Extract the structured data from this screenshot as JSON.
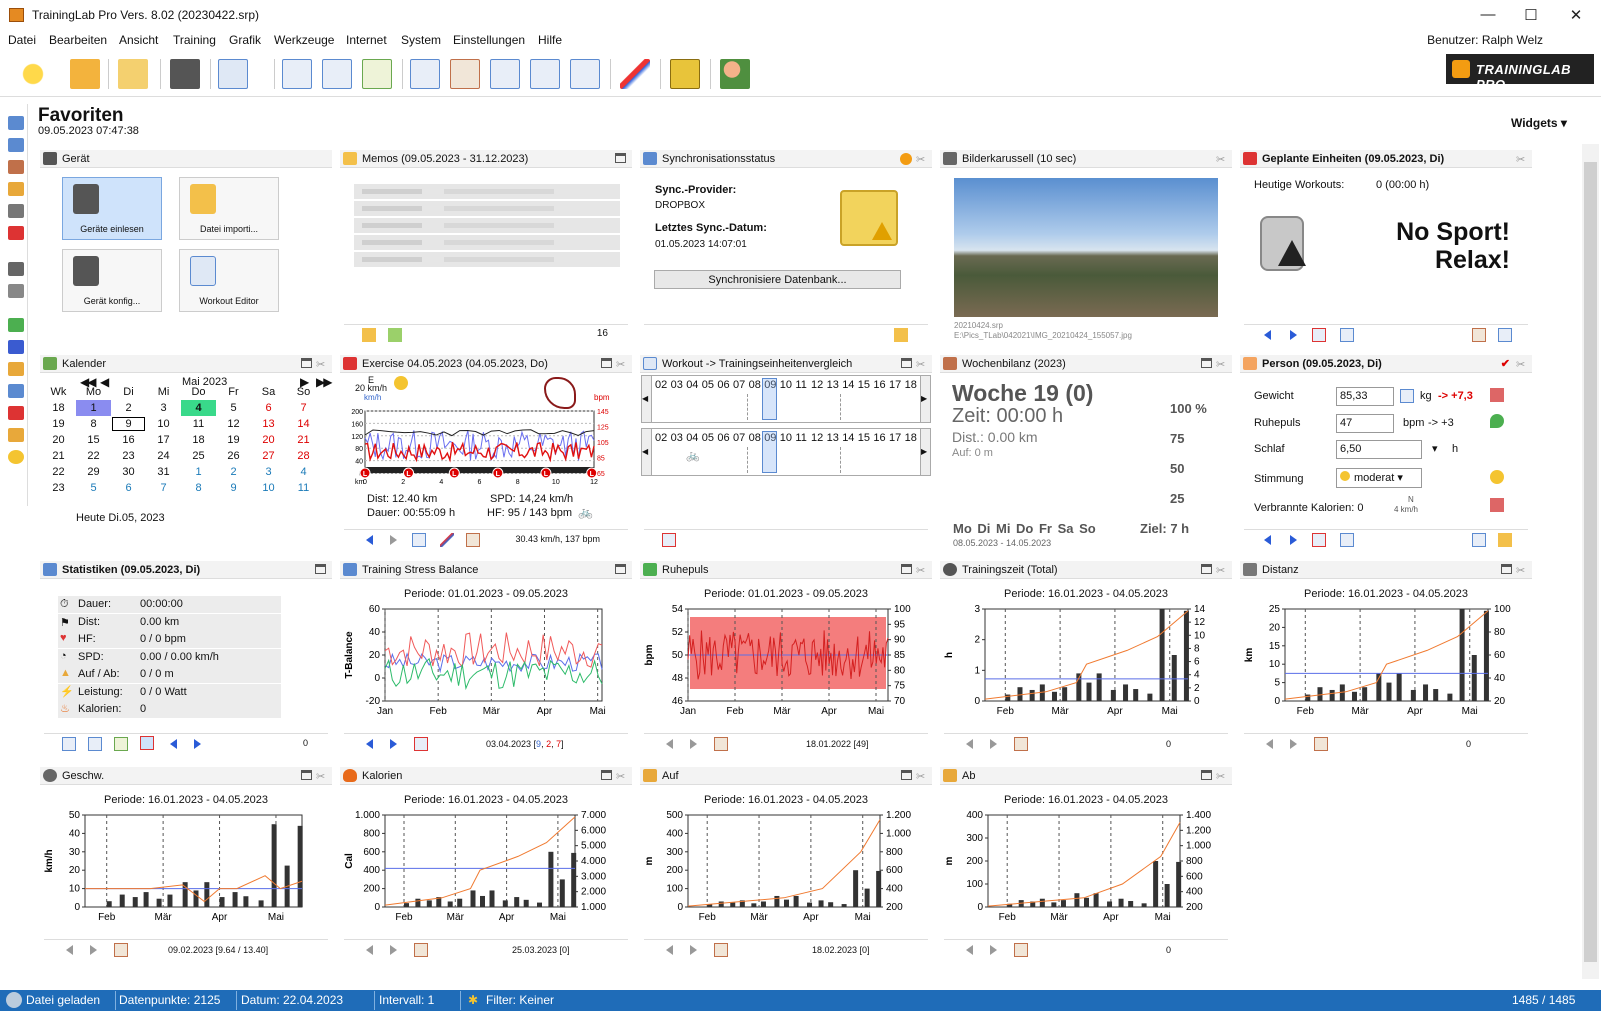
{
  "window": {
    "title": "TrainingLab Pro Vers. 8.02 (20230422.srp)",
    "minimize": "—",
    "maximize": "☐",
    "close": "✕"
  },
  "menu": [
    "Datei",
    "Bearbeiten",
    "Ansicht",
    "Training",
    "Grafik",
    "Werkzeuge",
    "Internet",
    "System",
    "Einstellungen",
    "Hilfe"
  ],
  "user": "Benutzer: Ralph Welz",
  "logo": "TRAININGLAB PRO",
  "page": {
    "title": "Favoriten",
    "date": "09.05.2023 07:47:38",
    "widgets": "Widgets"
  },
  "panels": {
    "geraet": {
      "title": "Gerät",
      "b1": "Geräte einlesen",
      "b2": "Datei importi...",
      "b3": "Gerät konfig...",
      "b4": "Workout Editor"
    },
    "memos": {
      "title": "Memos (09.05.2023 - 31.12.2023)",
      "count": "16"
    },
    "sync": {
      "title": "Synchronisationsstatus",
      "provider_label": "Sync.-Provider:",
      "provider": "DROPBOX",
      "last_label": "Letztes Sync.-Datum:",
      "last": "01.05.2023 14:07:01",
      "button": "Synchronisiere Datenbank..."
    },
    "bilder": {
      "title": "Bilderkarussell (10 sec)",
      "file": "20210424.srp",
      "path": "E:\\Pics_TLab\\042021\\IMG_20210424_155057.jpg"
    },
    "geplant": {
      "title": "Geplante Einheiten (09.05.2023, Di)",
      "label": "Heutige Workouts:",
      "value": "0 (00:00 h)",
      "line1": "No Sport!",
      "line2": "Relax!"
    },
    "kalender": {
      "title": "Kalender",
      "month": "Mai 2023",
      "today": "Heute Di.05, 2023",
      "head": [
        "Wk",
        "Mo",
        "Di",
        "Mi",
        "Do",
        "Fr",
        "Sa",
        "So"
      ],
      "rows": [
        [
          "18",
          "1",
          "2",
          "3",
          "4",
          "5",
          "6",
          "7"
        ],
        [
          "19",
          "8",
          "9",
          "10",
          "11",
          "12",
          "13",
          "14"
        ],
        [
          "20",
          "15",
          "16",
          "17",
          "18",
          "19",
          "20",
          "21"
        ],
        [
          "21",
          "22",
          "23",
          "24",
          "25",
          "26",
          "27",
          "28"
        ],
        [
          "22",
          "29",
          "30",
          "31",
          "1",
          "2",
          "3",
          "4"
        ],
        [
          "23",
          "5",
          "6",
          "7",
          "8",
          "9",
          "10",
          "11"
        ]
      ]
    },
    "exercise": {
      "title": "Exercise 04.05.2023 (04.05.2023, Do)",
      "wind": "20 km/h",
      "dir": "E",
      "dist": "Dist: 12.40 km",
      "spd": "SPD: 14,24 km/h",
      "dauer": "Dauer: 00:55:09 h",
      "hf": "HF: 95 / 143 bpm",
      "foot": "30.43 km/h, 137 bpm",
      "unit_l": "km/h",
      "unit_r": "bpm",
      "xlab": "km",
      "y_left": [
        "200",
        "160",
        "120",
        "80",
        "40",
        "0"
      ],
      "y_right": [
        "145",
        "125",
        "105",
        "85",
        "65"
      ],
      "x_ticks": [
        "0",
        "2",
        "4",
        "6",
        "8",
        "10",
        "12"
      ]
    },
    "workout": {
      "title": "Workout -> Trainingseinheitenvergleich",
      "nums": [
        "02",
        "03",
        "04",
        "05",
        "06",
        "07",
        "08",
        "09",
        "10",
        "11",
        "12",
        "13",
        "14",
        "15",
        "16",
        "17",
        "18"
      ]
    },
    "woche": {
      "title": "Wochenbilanz (2023)",
      "week": "Woche 19 (0)",
      "zeit": "Zeit: 00:00 h",
      "dist": "Dist.: 0.00 km",
      "auf": "Auf: 0 m",
      "p100": "100 %",
      "p75": "75",
      "p50": "50",
      "p25": "25",
      "days": "Mo Di Mi Do Fr Sa So",
      "ziel": "Ziel: 7 h",
      "range": "08.05.2023 - 14.05.2023"
    },
    "person": {
      "title": "Person (09.05.2023, Di)",
      "gewicht_l": "Gewicht",
      "gewicht": "85,33",
      "kg": "kg",
      "delta": "-> +7,3",
      "ruhe_l": "Ruhepuls",
      "ruhe": "47",
      "bpm": "bpm",
      "ruhe_d": "-> +3",
      "schlaf_l": "Schlaf",
      "schlaf": "6,50",
      "h": "h",
      "stimmung_l": "Stimmung",
      "stimmung": "moderat",
      "kal_l": "Verbrannte Kalorien: 0",
      "wind_dir": "N",
      "wind": "4 km/h"
    },
    "stat": {
      "title": "Statistiken (09.05.2023, Di)",
      "rows": [
        [
          "Dauer:",
          "00:00:00"
        ],
        [
          "Dist:",
          "0.00 km"
        ],
        [
          "HF:",
          "0 / 0 bpm"
        ],
        [
          "SPD:",
          "0.00 / 0.00 km/h"
        ],
        [
          "Auf / Ab:",
          "0 / 0 m"
        ],
        [
          "Leistung:",
          "0 / 0 Watt"
        ],
        [
          "Kalorien:",
          "0"
        ]
      ],
      "count": "0"
    },
    "tsb": {
      "title": "Training Stress Balance",
      "period": "Periode: 01.01.2023 - 09.05.2023",
      "ylabel": "T-Balance",
      "foot_date": "03.04.2023 [",
      "foot_a": "9",
      "foot_sep": ", ",
      "foot_b": "2",
      "foot_sep2": ", ",
      "foot_c": "7",
      "foot_end": "]",
      "months": [
        "Jan",
        "Feb",
        "Mär",
        "Apr",
        "Mai"
      ],
      "yticks": [
        "60",
        "40",
        "20",
        "0",
        "-20"
      ]
    },
    "ruhepuls": {
      "title": "Ruhepuls",
      "period": "Periode: 01.01.2023 - 09.05.2023",
      "ylabel": "bpm",
      "foot": "18.01.2022 [49]",
      "months": [
        "Jan",
        "Feb",
        "Mär",
        "Apr",
        "Mai"
      ],
      "yticks": [
        "54",
        "52",
        "50",
        "48",
        "46"
      ],
      "yticks_r": [
        "100",
        "95",
        "90",
        "85",
        "80",
        "75",
        "70"
      ]
    },
    "tzeit": {
      "title": "Trainingszeit (Total)",
      "period": "Periode: 16.01.2023 - 04.05.2023",
      "ylabel": "h",
      "foot": "0",
      "months": [
        "Feb",
        "Mär",
        "Apr",
        "Mai"
      ],
      "yticks": [
        "3",
        "2",
        "1",
        "0"
      ],
      "yticks_r": [
        "14",
        "12",
        "10",
        "8",
        "6",
        "4",
        "2",
        "0"
      ]
    },
    "distanz": {
      "title": "Distanz",
      "period": "Periode: 16.01.2023 - 04.05.2023",
      "ylabel": "km",
      "foot": "0",
      "months": [
        "Feb",
        "Mär",
        "Apr",
        "Mai"
      ],
      "yticks": [
        "25",
        "20",
        "15",
        "10",
        "5",
        "0"
      ],
      "yticks_r": [
        "100",
        "80",
        "60",
        "40",
        "20"
      ]
    },
    "geschw": {
      "title": "Geschw.",
      "period": "Periode: 16.01.2023 - 04.05.2023",
      "ylabel": "km/h",
      "foot": "09.02.2023 [9.64 / 13.40]",
      "months": [
        "Feb",
        "Mär",
        "Apr",
        "Mai"
      ],
      "yticks": [
        "50",
        "40",
        "30",
        "20",
        "10",
        "0"
      ],
      "yticks_r": []
    },
    "kalorien": {
      "title": "Kalorien",
      "period": "Periode: 16.01.2023 - 04.05.2023",
      "ylabel": "Cal",
      "foot": "25.03.2023 [0]",
      "months": [
        "Feb",
        "Mär",
        "Apr",
        "Mai"
      ],
      "yticks": [
        "1.000",
        "800",
        "600",
        "400",
        "200",
        "0"
      ],
      "yticks_r": [
        "7.000",
        "6.000",
        "5.000",
        "4.000",
        "3.000",
        "2.000",
        "1.000"
      ]
    },
    "auf": {
      "title": "Auf",
      "period": "Periode: 16.01.2023 - 04.05.2023",
      "ylabel": "m",
      "foot": "18.02.2023 [0]",
      "months": [
        "Feb",
        "Mär",
        "Apr",
        "Mai"
      ],
      "yticks": [
        "500",
        "400",
        "300",
        "200",
        "100",
        "0"
      ],
      "yticks_r": [
        "1.200",
        "1.000",
        "800",
        "600",
        "400",
        "200"
      ]
    },
    "ab": {
      "title": "Ab",
      "period": "Periode: 16.01.2023 - 04.05.2023",
      "ylabel": "m",
      "foot": "0",
      "months": [
        "Feb",
        "Mär",
        "Apr",
        "Mai"
      ],
      "yticks": [
        "400",
        "300",
        "200",
        "100",
        "0"
      ],
      "yticks_r": [
        "1.400",
        "1.200",
        "1.000",
        "800",
        "600",
        "400",
        "200"
      ]
    }
  },
  "status": {
    "s1": "Datei geladen",
    "s2": "Datenpunkte: 2125",
    "s3": "Datum: 22.04.2023",
    "s4": "Intervall: 1",
    "s5": "Filter: Keiner",
    "s6": "1485 / 1485"
  }
}
